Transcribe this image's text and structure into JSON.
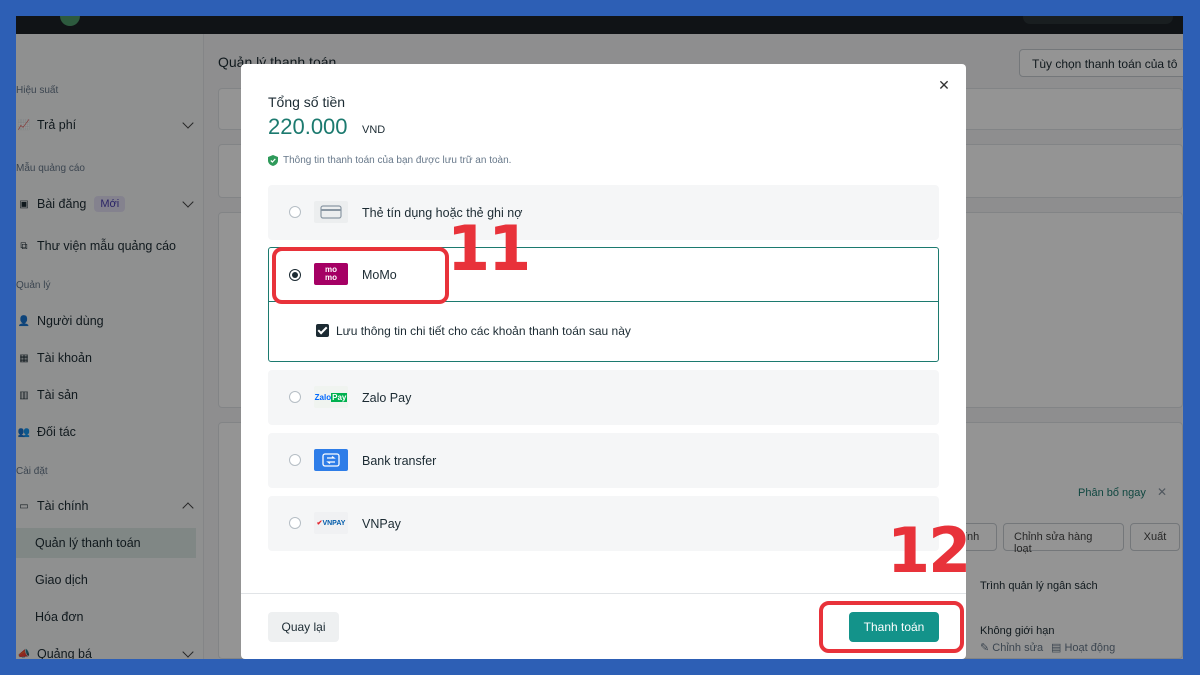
{
  "sidebar": {
    "sections": [
      "Hiệu suất",
      "Mẫu quảng cáo",
      "Quản lý",
      "Cài đặt"
    ],
    "items": [
      {
        "label": "Trả phí"
      },
      {
        "label": "Bài đăng",
        "badge": "Mới"
      },
      {
        "label": "Thư viện mẫu quảng cáo"
      },
      {
        "label": "Người dùng"
      },
      {
        "label": "Tài khoản"
      },
      {
        "label": "Tài sản"
      },
      {
        "label": "Đối tác"
      },
      {
        "label": "Tài chính"
      },
      {
        "label": "Quảng bá"
      }
    ],
    "finance_sub": [
      "Quản lý thanh toán",
      "Giao dịch",
      "Hóa đơn"
    ]
  },
  "main": {
    "title": "Quản lý thanh toán",
    "options_button": "Tùy chọn thanh toán của tô",
    "allocate_link": "Phân bổ ngay",
    "bulk_edit_button": "Chỉnh sửa hàng loạt",
    "export_button": "Xuất",
    "partial_button": "ính",
    "budget_header": "Trình quản lý ngân sách",
    "unlimited": "Không giới hạn",
    "edit_link": "Chỉnh sửa",
    "activity_link": "Hoạt động"
  },
  "modal": {
    "total_label": "Tổng số tiền",
    "total_amount": "220.000",
    "currency": "VND",
    "secure_note": "Thông tin thanh toán của bạn được lưu trữ an toàn.",
    "methods": [
      {
        "label": "Thẻ tín dụng hoặc thẻ ghi nợ",
        "icon": "credit-card-icon",
        "selected": false
      },
      {
        "label": "MoMo",
        "icon": "momo-logo",
        "selected": true
      },
      {
        "label": "Zalo Pay",
        "icon": "zalopay-logo",
        "selected": false
      },
      {
        "label": "Bank transfer",
        "icon": "bank-transfer-icon",
        "selected": false
      },
      {
        "label": "VNPay",
        "icon": "vnpay-logo",
        "selected": false
      }
    ],
    "momo_logo_text": "mo mo",
    "zalopay_logo_text": "ZaloPay",
    "vnpay_logo_text": "VNPAY",
    "save_details_label": "Lưu thông tin chi tiết cho các khoản thanh toán sau này",
    "save_details_checked": true,
    "back_button": "Quay lại",
    "pay_button": "Thanh toán"
  },
  "annotations": {
    "step_1": "11",
    "step_2": "12",
    "color": "#e8323a"
  }
}
